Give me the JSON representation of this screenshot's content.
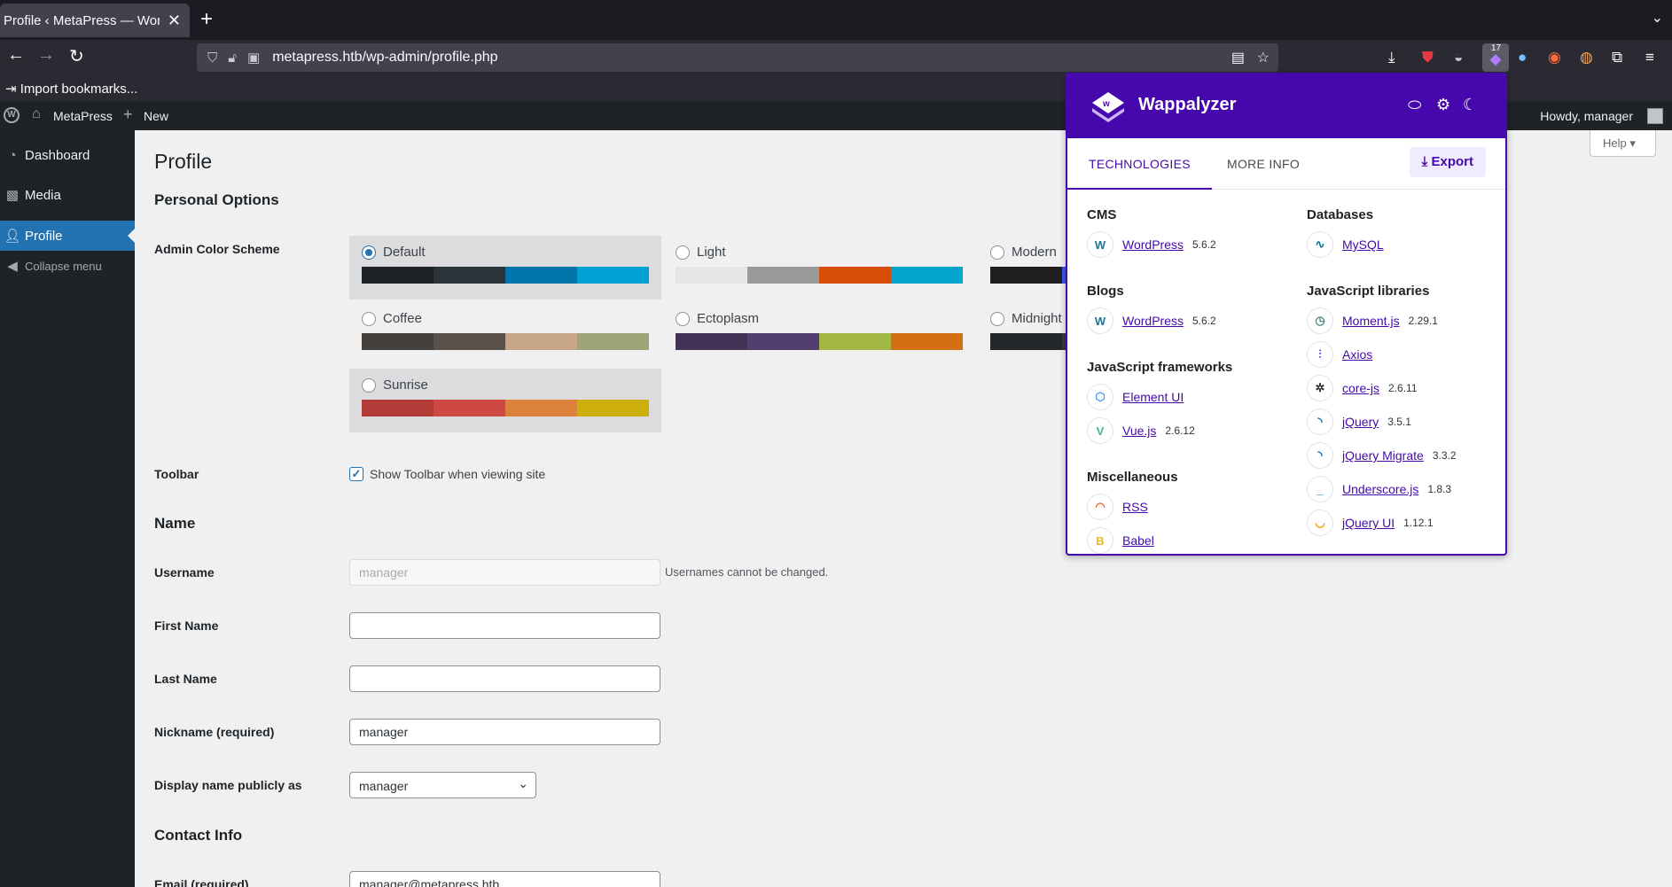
{
  "browser": {
    "tab_title": "Profile ‹ MetaPress — WordPress",
    "url": "metapress.htb/wp-admin/profile.php",
    "bookmarks_label": "Import bookmarks...",
    "ext_badge": "17"
  },
  "adminbar": {
    "site_name": "MetaPress",
    "new_label": "New",
    "howdy": "Howdy, manager"
  },
  "sidebar": {
    "items": [
      {
        "label": "Dashboard"
      },
      {
        "label": "Media"
      },
      {
        "label": "Profile"
      },
      {
        "label": "Collapse menu"
      }
    ]
  },
  "page": {
    "help": "Help",
    "title": "Profile",
    "personal_options": "Personal Options",
    "color_scheme_label": "Admin Color Scheme",
    "schemes": [
      {
        "name": "Default",
        "selected": true,
        "colors": [
          "#1d2327",
          "#2c3338",
          "#2271b1",
          "#72aee6"
        ]
      },
      {
        "name": "Light",
        "selected": false,
        "colors": [
          "#e5e5e5",
          "#999999",
          "#d64e07",
          "#04a4cc"
        ]
      },
      {
        "name": "Modern",
        "selected": false,
        "colors": [
          "#1e1e1e",
          "#3858e9",
          "#33f078",
          "#6ab4d9"
        ]
      },
      {
        "name": "Coffee",
        "selected": false,
        "colors": [
          "#46403c",
          "#59524c",
          "#c7a589",
          "#9ea476"
        ]
      },
      {
        "name": "Ectoplasm",
        "selected": false,
        "colors": [
          "#413256",
          "#523f6d",
          "#a3b745",
          "#d46f15"
        ]
      },
      {
        "name": "Midnight",
        "selected": false,
        "colors": [
          "#25282b",
          "#363b3f",
          "#69a8bb",
          "#a89d8a"
        ]
      },
      {
        "name": "Sunrise",
        "selected": false,
        "colors": [
          "#b43c38",
          "#cf4944",
          "#dd823b",
          "#ccaf0b"
        ]
      }
    ],
    "toolbar_label": "Toolbar",
    "toolbar_checkbox": "Show Toolbar when viewing site",
    "name_heading": "Name",
    "username_label": "Username",
    "username_value": "manager",
    "username_desc": "Usernames cannot be changed.",
    "first_name_label": "First Name",
    "first_name_value": "",
    "last_name_label": "Last Name",
    "last_name_value": "",
    "nickname_label": "Nickname (required)",
    "nickname_value": "manager",
    "display_name_label": "Display name publicly as",
    "display_name_value": "manager",
    "contact_heading": "Contact Info",
    "email_label": "Email (required)",
    "email_value": "manager@metapress.htb"
  },
  "wappalyzer": {
    "title": "Wappalyzer",
    "tab_tech": "TECHNOLOGIES",
    "tab_more": "MORE INFO",
    "export": "Export",
    "categories": {
      "cms": "CMS",
      "blogs": "Blogs",
      "js_frameworks": "JavaScript frameworks",
      "misc": "Miscellaneous",
      "databases": "Databases",
      "js_libraries": "JavaScript libraries"
    },
    "techs": {
      "wp_cms": {
        "name": "WordPress",
        "version": "5.6.2"
      },
      "wp_blogs": {
        "name": "WordPress",
        "version": "5.6.2"
      },
      "element_ui": {
        "name": "Element UI",
        "version": ""
      },
      "vue": {
        "name": "Vue.js",
        "version": "2.6.12"
      },
      "rss": {
        "name": "RSS",
        "version": ""
      },
      "babel": {
        "name": "Babel",
        "version": ""
      },
      "mysql": {
        "name": "MySQL",
        "version": ""
      },
      "moment": {
        "name": "Moment.js",
        "version": "2.29.1"
      },
      "axios": {
        "name": "Axios",
        "version": ""
      },
      "corejs": {
        "name": "core-js",
        "version": "2.6.11"
      },
      "jquery": {
        "name": "jQuery",
        "version": "3.5.1"
      },
      "jquery_migrate": {
        "name": "jQuery Migrate",
        "version": "3.3.2"
      },
      "underscore": {
        "name": "Underscore.js",
        "version": "1.8.3"
      },
      "jquery_ui": {
        "name": "jQuery UI",
        "version": "1.12.1"
      }
    }
  }
}
